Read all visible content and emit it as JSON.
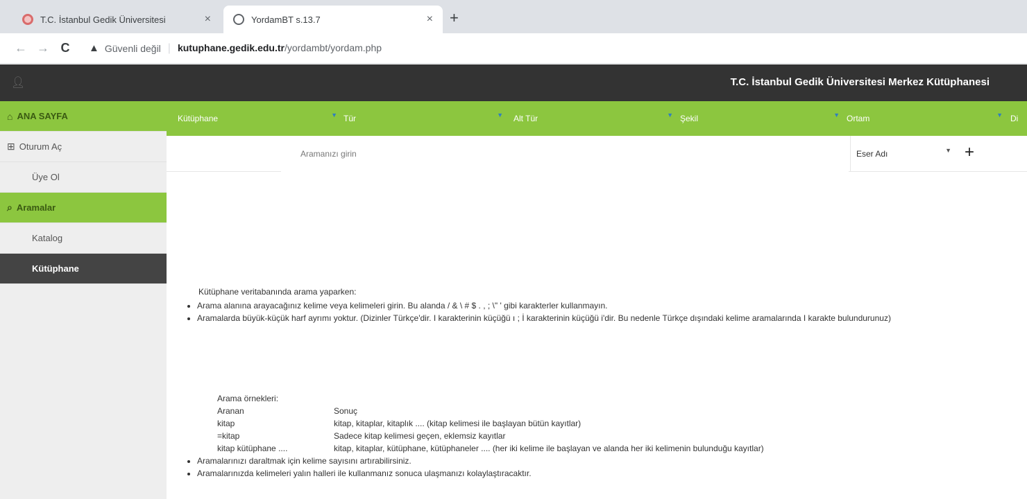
{
  "browser": {
    "tabs": [
      {
        "title": "T.C. İstanbul Gedik Üniversitesi",
        "close": "×"
      },
      {
        "title": "YordamBT s.13.7",
        "close": "×"
      }
    ],
    "new_tab": "+",
    "nav": {
      "back": "←",
      "forward": "→",
      "reload": "C"
    },
    "security": {
      "icon": "▲",
      "label": "Güvenli değil",
      "separator": "|"
    },
    "url": {
      "host": "kutuphane.gedik.edu.tr",
      "path": "/yordambt/yordam.php"
    }
  },
  "header": {
    "title": "T.C. İstanbul Gedik Üniversitesi Merkez Kütüphanesi"
  },
  "sidebar": {
    "items": [
      {
        "label": "ANA SAYFA",
        "icon": "home-icon"
      },
      {
        "label": "Oturum Aç",
        "icon": "login-icon"
      },
      {
        "label": "Üye Ol"
      },
      {
        "label": "Aramalar",
        "icon": "search-icon"
      },
      {
        "label": "Katalog"
      },
      {
        "label": "Kütüphane"
      }
    ]
  },
  "filters": [
    {
      "label": "Kütüphane"
    },
    {
      "label": "Tür"
    },
    {
      "label": "Alt Tür"
    },
    {
      "label": "Şekil"
    },
    {
      "label": "Ortam"
    },
    {
      "label": "Di"
    }
  ],
  "search": {
    "placeholder": "Aramanızı girin",
    "field": "Eser Adı",
    "add": "+"
  },
  "help": {
    "intro": "Kütüphane veritabanında arama yaparken:",
    "bullets": [
      "Arama alanına arayacağınız kelime veya kelimeleri girin. Bu alanda / & \\ # $ . , ; \\\" ' gibi karakterler kullanmayın.",
      "Aramalarda büyük-küçük harf ayrımı yoktur. (Dizinler Türkçe'dir. I karakterinin küçüğü ı ; İ karakterinin küçüğü i'dir. Bu nedenle Türkçe dışındaki kelime aramalarında I karakte bulundurunuz)"
    ],
    "examples_title": "Arama örnekleri:",
    "examples": [
      [
        "Aranan",
        "Sonuç"
      ],
      [
        "kitap",
        "kitap, kitaplar, kitaplık .... (kitap kelimesi ile başlayan bütün kayıtlar)"
      ],
      [
        "=kitap",
        "Sadece kitap kelimesi geçen, eklemsiz kayıtlar"
      ],
      [
        "kitap kütüphane ....",
        "kitap, kitaplar, kütüphane, kütüphaneler .... (her iki kelime ile başlayan ve alanda her iki kelimenin bulunduğu kayıtlar)"
      ]
    ],
    "bullets2": [
      "Aramalarınızı daraltmak için kelime sayısını artırabilirsiniz.",
      "Aramalarınızda kelimeleri yalın halleri ile kullanmanız sonuca ulaşmanızı kolaylaştıracaktır."
    ]
  },
  "colors": {
    "accent": "#8cc63f",
    "topbar": "#333333",
    "active_item": "#444444"
  }
}
